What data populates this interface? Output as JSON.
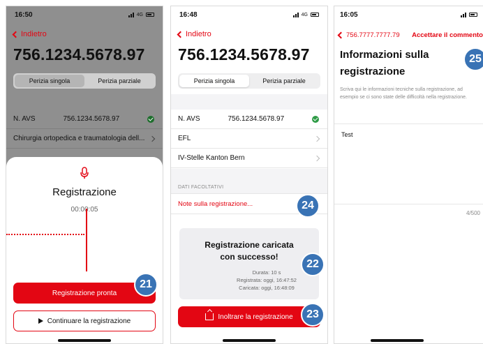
{
  "colors": {
    "accent": "#e30613",
    "badge": "#3973b5",
    "success": "#2e9b46"
  },
  "screen1": {
    "time": "16:50",
    "network": "4G",
    "back_label": "Indietro",
    "title": "756.1234.5678.97",
    "tabs": [
      "Perizia singola",
      "Perizia parziale"
    ],
    "rows": [
      {
        "label": "N. AVS",
        "value": "756.1234.5678.97"
      },
      {
        "label": "Chirurgia ortopedica e traumatologia dell..."
      }
    ],
    "sheet": {
      "icon": "microphone-icon",
      "title": "Registrazione",
      "timer": "00:00:05",
      "primary_button": "Registrazione pronta",
      "secondary_button": "Continuare la registrazione"
    },
    "badge": "21"
  },
  "screen2": {
    "time": "16:48",
    "network": "4G",
    "back_label": "Indietro",
    "title": "756.1234.5678.97",
    "tabs": [
      "Perizia singola",
      "Perizia parziale"
    ],
    "rows": [
      {
        "label": "N. AVS",
        "value": "756.1234.5678.97"
      },
      {
        "label": "EFL"
      },
      {
        "label": "IV-Stelle Kanton Bern"
      }
    ],
    "optional_label": "DATI FACOLTATIVI",
    "note_link": "Note sulla registrazione...",
    "card": {
      "title_line1": "Registrazione caricata",
      "title_line2": "con successo!",
      "duration": "Durata: 10 s",
      "recorded": "Registrata: oggi, 16:47:52",
      "uploaded": "Caricata: oggi, 16:48:09"
    },
    "forward_button": "Inoltrare la registrazione",
    "badges": [
      "24",
      "22",
      "23"
    ]
  },
  "screen3": {
    "time": "16:05",
    "back_label": "756.7777.7777.79",
    "accept_label": "Accettare il commento",
    "title": "Informazioni sulla registrazione",
    "description": "Scriva qui le informazioni tecniche sulla registrazione, ad esempio se ci sono state delle difficoltà nella registrazione.",
    "text_value": "Test",
    "counter": "4/500",
    "badge": "25"
  }
}
